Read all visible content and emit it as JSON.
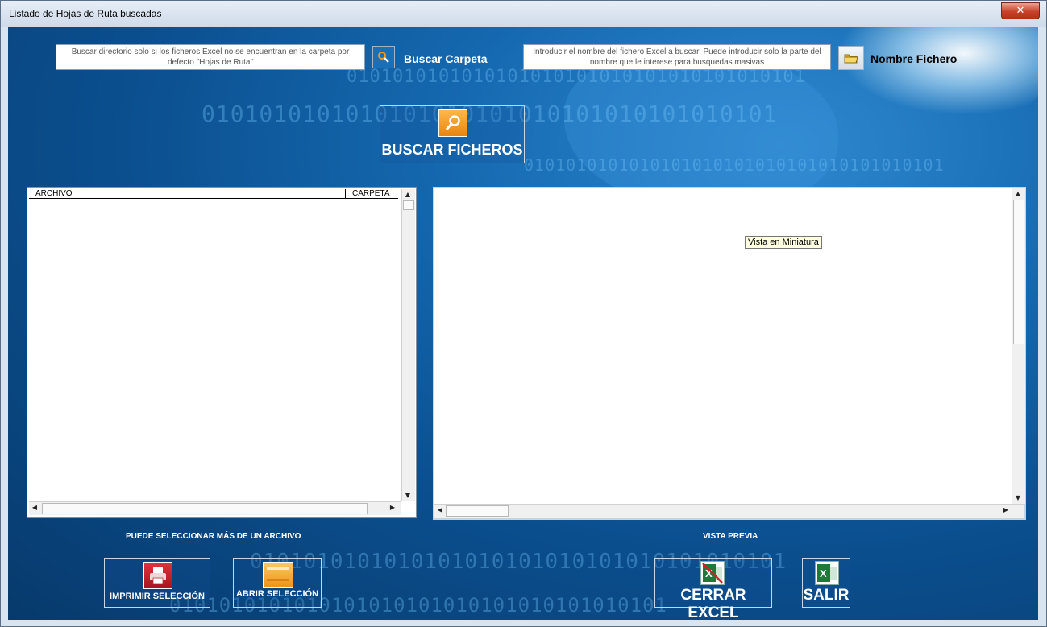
{
  "window": {
    "title": "Listado de Hojas de Ruta buscadas",
    "close_label": "✕"
  },
  "background": {
    "binary_text": "0101010101010101010101010101010101010101"
  },
  "search_folder": {
    "field_text": "Buscar directorio solo si los ficheros Excel no se encuentran en la carpeta por defecto \"Hojas de Ruta\"",
    "button_label": "Buscar Carpeta",
    "icon": "magnifier-icon"
  },
  "file_name": {
    "field_text": "Introducir el nombre del fichero Excel a buscar. Puede introducir solo la parte del nombre que le interese para busquedas masivas",
    "button_label": "Nombre Fichero",
    "icon": "folder-icon"
  },
  "search_button": {
    "label": "BUSCAR FICHEROS",
    "icon": "magnifier-icon"
  },
  "file_list": {
    "columns": [
      "ARCHIVO",
      "CARPETA"
    ],
    "rows": [],
    "caption": "PUEDE SELECCIONAR MÁS DE UN ARCHIVO"
  },
  "preview": {
    "tooltip": "Vista en Miniatura",
    "caption": "VISTA PREVIA"
  },
  "actions": {
    "print_label": "IMPRIMIR SELECCIÓN",
    "open_label": "ABRIR SELECCIÓN",
    "close_excel_label": "CERRAR EXCEL",
    "exit_label": "SALIR"
  },
  "colors": {
    "accent_orange": "#f29b1d",
    "print_red": "#c8202a",
    "excel_green": "#1f7a3a",
    "background_blue": "#0b4f8f"
  }
}
